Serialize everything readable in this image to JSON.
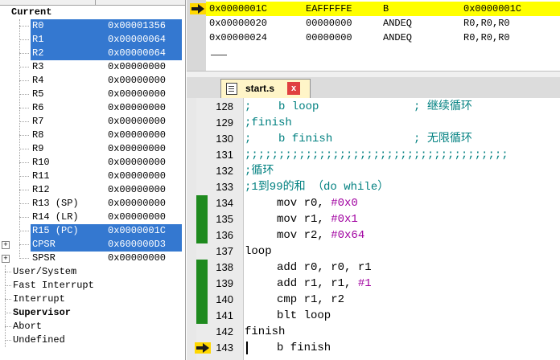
{
  "registers": {
    "group_label": "Current",
    "items": [
      {
        "name": "R0",
        "value": "0x00001356",
        "selected": true
      },
      {
        "name": "R1",
        "value": "0x00000064",
        "selected": true
      },
      {
        "name": "R2",
        "value": "0x00000064",
        "selected": true
      },
      {
        "name": "R3",
        "value": "0x00000000",
        "selected": false
      },
      {
        "name": "R4",
        "value": "0x00000000",
        "selected": false
      },
      {
        "name": "R5",
        "value": "0x00000000",
        "selected": false
      },
      {
        "name": "R6",
        "value": "0x00000000",
        "selected": false
      },
      {
        "name": "R7",
        "value": "0x00000000",
        "selected": false
      },
      {
        "name": "R8",
        "value": "0x00000000",
        "selected": false
      },
      {
        "name": "R9",
        "value": "0x00000000",
        "selected": false
      },
      {
        "name": "R10",
        "value": "0x00000000",
        "selected": false
      },
      {
        "name": "R11",
        "value": "0x00000000",
        "selected": false
      },
      {
        "name": "R12",
        "value": "0x00000000",
        "selected": false
      },
      {
        "name": "R13 (SP)",
        "value": "0x00000000",
        "selected": false
      },
      {
        "name": "R14 (LR)",
        "value": "0x00000000",
        "selected": false
      },
      {
        "name": "R15 (PC)",
        "value": "0x0000001C",
        "selected": true
      },
      {
        "name": "CPSR",
        "value": "0x600000D3",
        "selected": true
      },
      {
        "name": "SPSR",
        "value": "0x00000000",
        "selected": false
      }
    ],
    "modes": [
      {
        "label": "User/System",
        "bold": false
      },
      {
        "label": "Fast Interrupt",
        "bold": false
      },
      {
        "label": "Interrupt",
        "bold": false
      },
      {
        "label": "Supervisor",
        "bold": true
      },
      {
        "label": "Abort",
        "bold": false
      },
      {
        "label": "Undefined",
        "bold": false
      }
    ]
  },
  "disassembly": {
    "rows": [
      {
        "addr": "0x0000001C",
        "opcode": "EAFFFFFE",
        "mnemonic": "B",
        "operands": "0x0000001C",
        "current": true
      },
      {
        "addr": "0x00000020",
        "opcode": "00000000",
        "mnemonic": "ANDEQ",
        "operands": "R0,R0,R0",
        "current": false
      },
      {
        "addr": "0x00000024",
        "opcode": "00000000",
        "mnemonic": "ANDEQ",
        "operands": "R0,R0,R0",
        "current": false
      }
    ]
  },
  "editor": {
    "tab_label": "start.s",
    "tab_close": "x",
    "lines": [
      {
        "num": "128",
        "text": ";    b loop              ; 继续循环",
        "kind": "comment",
        "marker": false
      },
      {
        "num": "129",
        "text": ";finish",
        "kind": "comment",
        "marker": false
      },
      {
        "num": "130",
        "text": ";    b finish            ; 无限循环",
        "kind": "comment",
        "marker": false
      },
      {
        "num": "131",
        "text": ";;;;;;;;;;;;;;;;;;;;;;;;;;;;;;;;;;;;;;;",
        "kind": "comment",
        "marker": false
      },
      {
        "num": "132",
        "text": ";循环",
        "kind": "comment",
        "marker": false
      },
      {
        "num": "133",
        "text": ";1到99的和 （do while）",
        "kind": "comment",
        "marker": false
      },
      {
        "num": "134",
        "text": "mov r0, #0x0",
        "kind": "instr",
        "indent": true,
        "marker": true,
        "imm": "#0x0",
        "pre": "mov r0, "
      },
      {
        "num": "135",
        "text": "mov r1, #0x1",
        "kind": "instr",
        "indent": true,
        "marker": true,
        "imm": "#0x1",
        "pre": "mov r1, "
      },
      {
        "num": "136",
        "text": "mov r2, #0x64",
        "kind": "instr",
        "indent": true,
        "marker": true,
        "imm": "#0x64",
        "pre": "mov r2, "
      },
      {
        "num": "137",
        "text": "loop",
        "kind": "label",
        "marker": false
      },
      {
        "num": "138",
        "text": "add r0, r0, r1",
        "kind": "instr",
        "indent": true,
        "marker": true,
        "imm": "",
        "pre": "add r0, r0, r1"
      },
      {
        "num": "139",
        "text": "add r1, r1, #1",
        "kind": "instr",
        "indent": true,
        "marker": true,
        "imm": "#1",
        "pre": "add r1, r1, "
      },
      {
        "num": "140",
        "text": "cmp r1, r2",
        "kind": "instr",
        "indent": true,
        "marker": true,
        "imm": "",
        "pre": "cmp r1, r2"
      },
      {
        "num": "141",
        "text": "blt loop",
        "kind": "instr",
        "indent": true,
        "marker": true,
        "imm": "",
        "pre": "blt loop"
      },
      {
        "num": "142",
        "text": "finish",
        "kind": "label",
        "marker": false
      },
      {
        "num": "143",
        "text": "b finish",
        "kind": "instr",
        "indent": true,
        "marker": false,
        "imm": "",
        "pre": "b finish",
        "current": true
      }
    ]
  },
  "colors": {
    "selection": "#3478d0",
    "current_line": "#ffff00",
    "executed_marker": "#1e8a1e",
    "comment": "#008080",
    "immediate": "#a000a0"
  }
}
